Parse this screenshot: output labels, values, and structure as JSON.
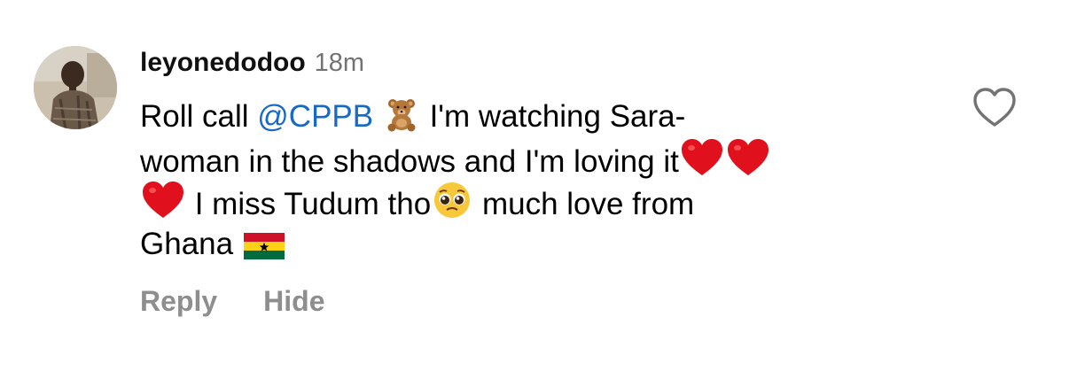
{
  "comment": {
    "username": "leyonedodoo",
    "timestamp": "18m",
    "text": {
      "line1_a": "Roll call ",
      "line1_mention": "@CPPB",
      "line1_b": " I'm watching Sara-",
      "line2": "woman in the shadows and I'm loving it",
      "line3_a": " I miss Tudum tho",
      "line3_b": " much love from",
      "line4": "Ghana "
    },
    "emojis": [
      "teddy-bear",
      "red-heart",
      "red-heart",
      "red-heart",
      "pleading-face",
      "ghana-flag"
    ]
  },
  "actions": {
    "reply_label": "Reply",
    "hide_label": "Hide"
  },
  "colors": {
    "mention": "#1769c7",
    "meta": "#737373",
    "action": "#8e8e8e",
    "heart": "#e0111d"
  },
  "icons": {
    "like": "heart-outline-icon"
  }
}
